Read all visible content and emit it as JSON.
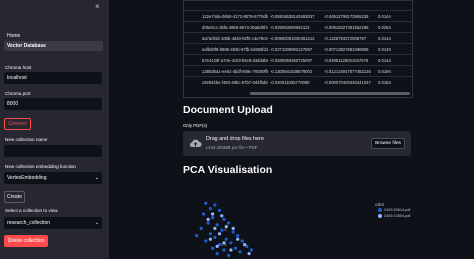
{
  "sidebar": {
    "close_icon": "×",
    "nav": [
      "Home",
      "Vector Database"
    ],
    "host_label": "Chroma host",
    "host_value": "localhost",
    "port_label": "Chroma port",
    "port_value": "8000",
    "connect_label": "Connect",
    "new_collection_label": "New collection name",
    "new_collection_value": "",
    "embedding_label": "New collection embedding function",
    "embedding_value": "VertexEmbedding",
    "create_label": "Create",
    "select_label": "Select a collection to view",
    "select_value": "research_collection",
    "delete_label": "Delete collection"
  },
  "table": {
    "rows": [
      [
        "122e74da-06b0-4172-8079-5770dfa8e95",
        "-0.05918638142693037",
        "-0.04912798173906238",
        "0.0144"
      ],
      [
        "d05e5cc-3bfa-4959-9574-30a8d0f4f55",
        "-0.025063060062113",
        "-0.00918327381562288",
        "0.0264"
      ],
      [
        "6a7a0f4d-108b-4d40-82f0-c4e78c621e3c",
        "-0.00892081030491212",
        "-0.1326793372008797",
        "0.0144"
      ],
      [
        "aafbd0f8-b896-404b-97fb-b4650fd42167",
        "-0.0271009902127097",
        "-0.00713827681090808",
        "0.0149"
      ],
      [
        "57e4126f-a74e-4c03-b6c9-d4dd4b82c1f7",
        "-0.0480059260725097",
        "-0.04961128031047076",
        "0.0144"
      ],
      [
        "1380d6a1-ee61-4bdf-809c-70000ff951e4",
        "-0.1300941536879002",
        "-0.012124047077452126",
        "0.0194"
      ],
      [
        "c92844be-f450-48bc-87b7-0d4fbd63f090",
        "-0.040011035770060",
        "-0.000070403430441047",
        "0.0184"
      ]
    ]
  },
  "document_upload": {
    "heading": "Document Upload",
    "file_label": "Only PDF(s)",
    "drag_text": "Drag and drop files here",
    "limit_text": "Limit 200MB per file • PDF",
    "browse_label": "Browse files"
  },
  "pca": {
    "heading": "PCA Visualisation",
    "legend_title": "color",
    "legend": [
      {
        "name": "2409.20614.pdf",
        "color": "#1f5ccf"
      },
      {
        "name": "2409.10504.pdf",
        "color": "#8fb8ff"
      }
    ]
  },
  "chart_data": {
    "type": "scatter",
    "y_ticks": [
      "0.5",
      "0.4"
    ],
    "series": [
      {
        "name": "2409.20614.pdf",
        "color": "#1f5ccf",
        "points": [
          [
            0.1,
            0.56
          ],
          [
            0.12,
            0.53
          ],
          [
            0.14,
            0.55
          ],
          [
            0.09,
            0.5
          ],
          [
            0.13,
            0.48
          ],
          [
            0.16,
            0.52
          ],
          [
            0.11,
            0.45
          ],
          [
            0.15,
            0.44
          ],
          [
            0.18,
            0.47
          ],
          [
            0.08,
            0.42
          ],
          [
            0.17,
            0.41
          ],
          [
            0.2,
            0.45
          ],
          [
            0.12,
            0.39
          ],
          [
            0.22,
            0.4
          ],
          [
            0.14,
            0.37
          ],
          [
            0.19,
            0.36
          ],
          [
            0.24,
            0.38
          ],
          [
            0.1,
            0.35
          ],
          [
            0.21,
            0.34
          ],
          [
            0.16,
            0.33
          ],
          [
            0.26,
            0.35
          ],
          [
            0.13,
            0.31
          ],
          [
            0.23,
            0.31
          ],
          [
            0.18,
            0.3
          ],
          [
            0.28,
            0.32
          ],
          [
            0.06,
            0.38
          ],
          [
            0.25,
            0.29
          ],
          [
            0.15,
            0.28
          ],
          [
            0.2,
            0.27
          ],
          [
            0.3,
            0.3
          ]
        ]
      },
      {
        "name": "2409.10504.pdf",
        "color": "#8fb8ff",
        "points": [
          [
            0.13,
            0.5
          ],
          [
            0.17,
            0.49
          ],
          [
            0.11,
            0.47
          ],
          [
            0.19,
            0.43
          ],
          [
            0.14,
            0.42
          ],
          [
            0.22,
            0.42
          ],
          [
            0.16,
            0.39
          ],
          [
            0.12,
            0.36
          ],
          [
            0.24,
            0.36
          ],
          [
            0.18,
            0.34
          ],
          [
            0.27,
            0.33
          ],
          [
            0.21,
            0.3
          ],
          [
            0.15,
            0.32
          ],
          [
            0.29,
            0.28
          ]
        ]
      }
    ],
    "xlim": [
      0,
      1
    ],
    "ylim": [
      0.25,
      0.6
    ]
  }
}
